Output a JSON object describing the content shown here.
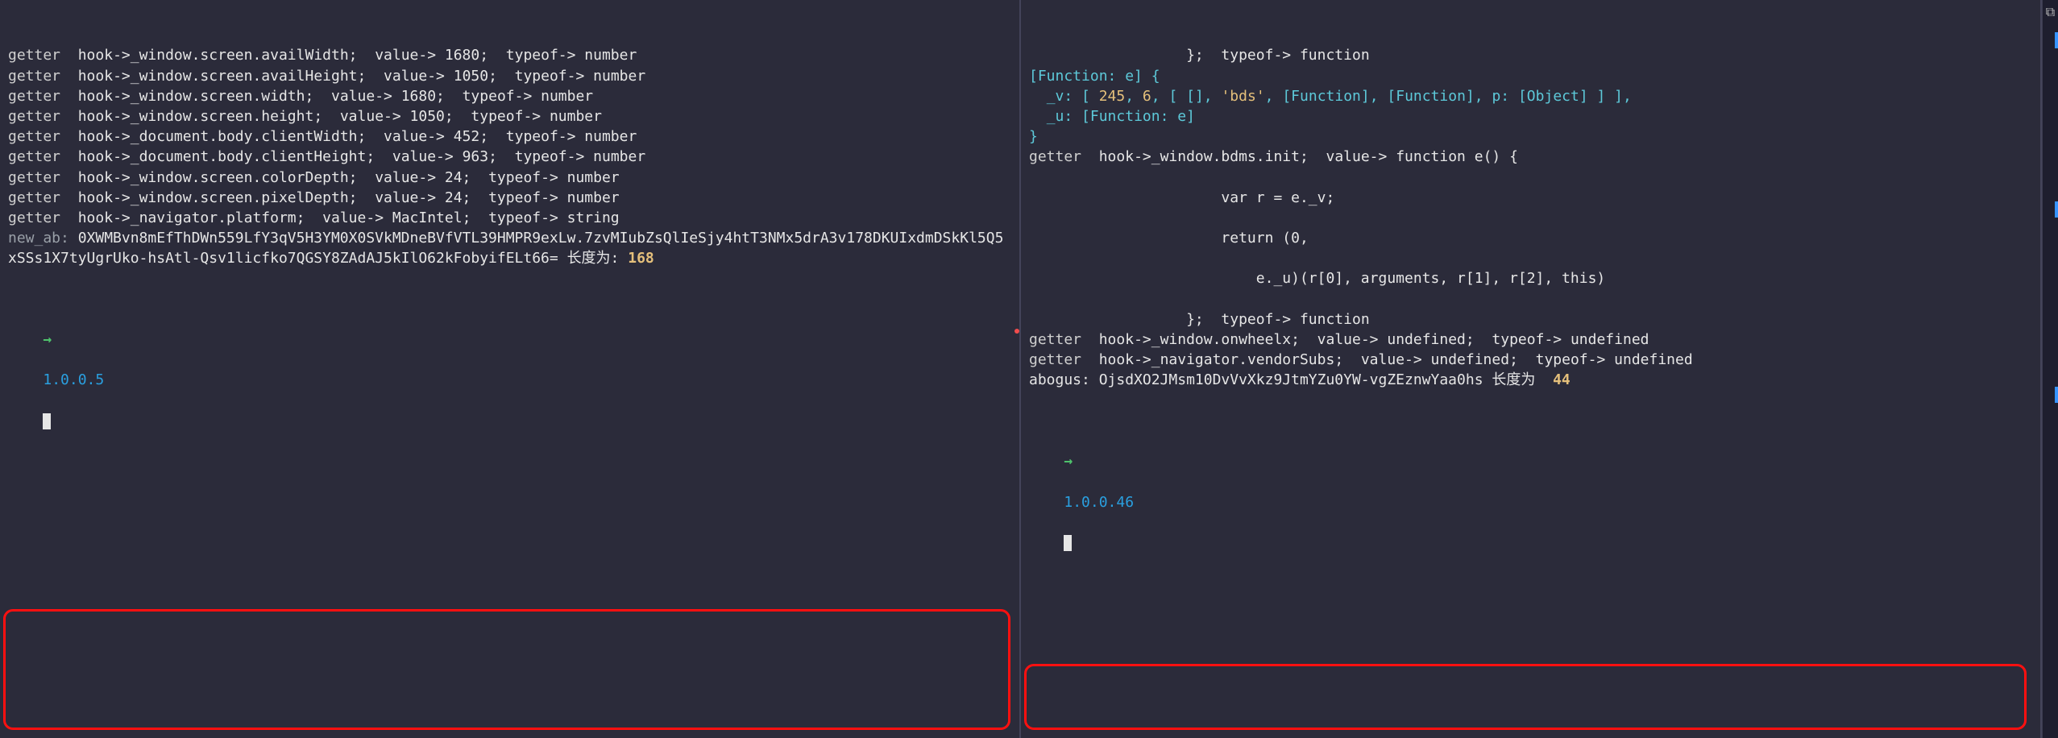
{
  "left": {
    "lines": [
      [
        {
          "text": "getter",
          "cls": "t-gray"
        },
        {
          "text": "  ",
          "cls": ""
        },
        {
          "text": "hook->_window.screen.availWidth;",
          "cls": "t-white"
        },
        {
          "text": "  ",
          "cls": ""
        },
        {
          "text": "value-> 1680;",
          "cls": "t-white"
        },
        {
          "text": "  ",
          "cls": ""
        },
        {
          "text": "typeof-> number",
          "cls": "t-white"
        }
      ],
      [
        {
          "text": "getter",
          "cls": "t-gray"
        },
        {
          "text": "  ",
          "cls": ""
        },
        {
          "text": "hook->_window.screen.availHeight;",
          "cls": "t-white"
        },
        {
          "text": "  ",
          "cls": ""
        },
        {
          "text": "value-> 1050;",
          "cls": "t-white"
        },
        {
          "text": "  ",
          "cls": ""
        },
        {
          "text": "typeof-> number",
          "cls": "t-white"
        }
      ],
      [
        {
          "text": "getter",
          "cls": "t-gray"
        },
        {
          "text": "  ",
          "cls": ""
        },
        {
          "text": "hook->_window.screen.width;",
          "cls": "t-white"
        },
        {
          "text": "  ",
          "cls": ""
        },
        {
          "text": "value-> 1680;",
          "cls": "t-white"
        },
        {
          "text": "  ",
          "cls": ""
        },
        {
          "text": "typeof-> number",
          "cls": "t-white"
        }
      ],
      [
        {
          "text": "getter",
          "cls": "t-gray"
        },
        {
          "text": "  ",
          "cls": ""
        },
        {
          "text": "hook->_window.screen.height;",
          "cls": "t-white"
        },
        {
          "text": "  ",
          "cls": ""
        },
        {
          "text": "value-> 1050;",
          "cls": "t-white"
        },
        {
          "text": "  ",
          "cls": ""
        },
        {
          "text": "typeof-> number",
          "cls": "t-white"
        }
      ],
      [
        {
          "text": "getter",
          "cls": "t-gray"
        },
        {
          "text": "  ",
          "cls": ""
        },
        {
          "text": "hook->_document.body.clientWidth;",
          "cls": "t-white"
        },
        {
          "text": "  ",
          "cls": ""
        },
        {
          "text": "value-> 452;",
          "cls": "t-white"
        },
        {
          "text": "  ",
          "cls": ""
        },
        {
          "text": "typeof-> number",
          "cls": "t-white"
        }
      ],
      [
        {
          "text": "getter",
          "cls": "t-gray"
        },
        {
          "text": "  ",
          "cls": ""
        },
        {
          "text": "hook->_document.body.clientHeight;",
          "cls": "t-white"
        },
        {
          "text": "  ",
          "cls": ""
        },
        {
          "text": "value-> 963;",
          "cls": "t-white"
        },
        {
          "text": "  ",
          "cls": ""
        },
        {
          "text": "typeof-> number",
          "cls": "t-white"
        }
      ],
      [
        {
          "text": "getter",
          "cls": "t-gray"
        },
        {
          "text": "  ",
          "cls": ""
        },
        {
          "text": "hook->_window.screen.colorDepth;",
          "cls": "t-white"
        },
        {
          "text": "  ",
          "cls": ""
        },
        {
          "text": "value-> 24;",
          "cls": "t-white"
        },
        {
          "text": "  ",
          "cls": ""
        },
        {
          "text": "typeof-> number",
          "cls": "t-white"
        }
      ],
      [
        {
          "text": "getter",
          "cls": "t-gray"
        },
        {
          "text": "  ",
          "cls": ""
        },
        {
          "text": "hook->_window.screen.pixelDepth;",
          "cls": "t-white"
        },
        {
          "text": "  ",
          "cls": ""
        },
        {
          "text": "value-> 24;",
          "cls": "t-white"
        },
        {
          "text": "  ",
          "cls": ""
        },
        {
          "text": "typeof-> number",
          "cls": "t-white"
        }
      ],
      [
        {
          "text": "getter",
          "cls": "t-gray"
        },
        {
          "text": "  ",
          "cls": ""
        },
        {
          "text": "hook->_navigator.platform;",
          "cls": "t-white"
        },
        {
          "text": "  ",
          "cls": ""
        },
        {
          "text": "value-> MacIntel;",
          "cls": "t-white"
        },
        {
          "text": "  ",
          "cls": ""
        },
        {
          "text": "typeof-> string",
          "cls": "t-white"
        }
      ],
      [
        {
          "text": "new_ab: ",
          "cls": "t-dim"
        },
        {
          "text": "0XWMBvn8mEfThDWn559LfY3qV5H3YM0X0SVkMDneBVfVTL39HMPR9exLw.7zvMIubZsQlIeSjy4htT3NMx5drA3v178DKUIxdmDSkKl5Q5xSSs1X7tyUgrUko-hsAtl-Qsv1licfko7QGSY8ZAdAJ5kIlO62kFobyifELt66= ",
          "cls": "t-white"
        },
        {
          "text": "长度为: ",
          "cls": "t-white"
        },
        {
          "text": "168",
          "cls": "t-lenv"
        }
      ]
    ],
    "prompt": {
      "arrow": "→",
      "ip": "1.0.0.5"
    }
  },
  "right": {
    "lines": [
      [
        {
          "text": "                  };  typeof-> function",
          "cls": "t-white"
        }
      ],
      [
        {
          "text": "[Function: e] {",
          "cls": "t-teal"
        }
      ],
      [
        {
          "text": "  _v: [ ",
          "cls": "t-teal"
        },
        {
          "text": "245",
          "cls": "t-yell"
        },
        {
          "text": ", ",
          "cls": "t-teal"
        },
        {
          "text": "6",
          "cls": "t-yell"
        },
        {
          "text": ", [ [], ",
          "cls": "t-teal"
        },
        {
          "text": "'bds'",
          "cls": "t-str"
        },
        {
          "text": ", ",
          "cls": "t-teal"
        },
        {
          "text": "[Function]",
          "cls": "t-teal"
        },
        {
          "text": ", ",
          "cls": "t-teal"
        },
        {
          "text": "[Function]",
          "cls": "t-teal"
        },
        {
          "text": ", p: ",
          "cls": "t-teal"
        },
        {
          "text": "[Object]",
          "cls": "t-teal"
        },
        {
          "text": " ] ],",
          "cls": "t-teal"
        }
      ],
      [
        {
          "text": "  _u: ",
          "cls": "t-teal"
        },
        {
          "text": "[Function: e]",
          "cls": "t-teal"
        }
      ],
      [
        {
          "text": "}",
          "cls": "t-teal"
        }
      ],
      [
        {
          "text": "getter",
          "cls": "t-gray"
        },
        {
          "text": "  ",
          "cls": ""
        },
        {
          "text": "hook->_window.bdms.init;",
          "cls": "t-white"
        },
        {
          "text": "  ",
          "cls": ""
        },
        {
          "text": "value-> function e() {",
          "cls": "t-white"
        }
      ],
      [
        {
          "text": " ",
          "cls": "t-white"
        }
      ],
      [
        {
          "text": "                      var r = e._v;",
          "cls": "t-white"
        }
      ],
      [
        {
          "text": " ",
          "cls": "t-white"
        }
      ],
      [
        {
          "text": "                      return (0,",
          "cls": "t-white"
        }
      ],
      [
        {
          "text": " ",
          "cls": "t-white"
        }
      ],
      [
        {
          "text": "                          e._u)(r[0], arguments, r[1], r[2], this)",
          "cls": "t-white"
        }
      ],
      [
        {
          "text": " ",
          "cls": "t-white"
        }
      ],
      [
        {
          "text": "                  };  typeof-> function",
          "cls": "t-white"
        }
      ],
      [
        {
          "text": "getter",
          "cls": "t-gray"
        },
        {
          "text": "  ",
          "cls": ""
        },
        {
          "text": "hook->_window.onwheelx;",
          "cls": "t-white"
        },
        {
          "text": "  ",
          "cls": ""
        },
        {
          "text": "value-> undefined;",
          "cls": "t-white"
        },
        {
          "text": "  ",
          "cls": ""
        },
        {
          "text": "typeof-> undefined",
          "cls": "t-white"
        }
      ],
      [
        {
          "text": "getter",
          "cls": "t-gray"
        },
        {
          "text": "  ",
          "cls": ""
        },
        {
          "text": "hook->_navigator.vendorSubs;",
          "cls": "t-white"
        },
        {
          "text": "  ",
          "cls": ""
        },
        {
          "text": "value-> undefined;",
          "cls": "t-white"
        },
        {
          "text": "  ",
          "cls": ""
        },
        {
          "text": "typeof-> undefined",
          "cls": "t-white"
        }
      ],
      [
        {
          "text": "abogus: ",
          "cls": "t-white"
        },
        {
          "text": "OjsdXO2JMsm10DvVvXkz9JtmYZu0YW-vgZEznwYaa0hs ",
          "cls": "t-white"
        },
        {
          "text": "长度为  ",
          "cls": "t-white"
        },
        {
          "text": "44",
          "cls": "t-lenv"
        }
      ]
    ],
    "prompt": {
      "arrow": "→",
      "ip": "1.0.0.46"
    }
  },
  "strip": {
    "icon": "⧉"
  }
}
